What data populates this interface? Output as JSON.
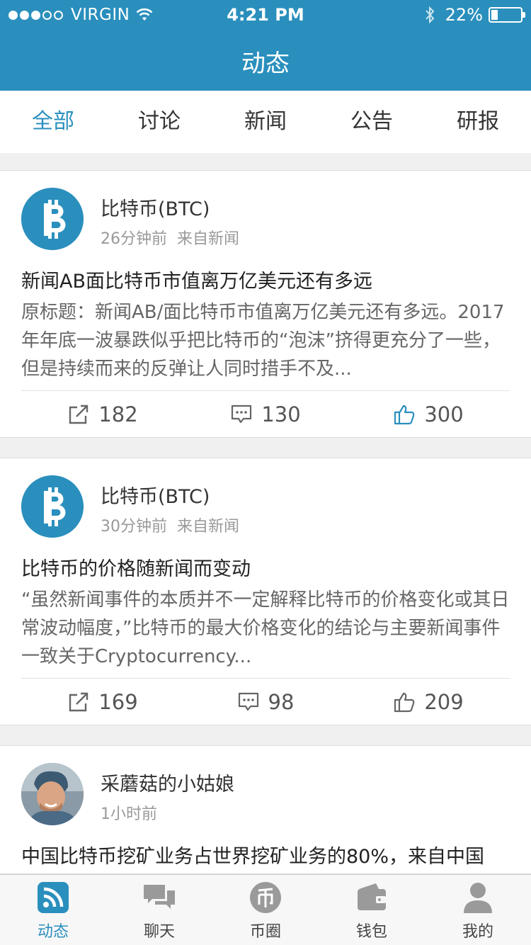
{
  "status_bar": {
    "carrier": "VIRGIN",
    "time": "4:21 PM",
    "battery": "22%",
    "battery_level": 0.22
  },
  "header": {
    "title": "动态"
  },
  "tabs": [
    {
      "label": "全部",
      "active": true
    },
    {
      "label": "讨论",
      "active": false
    },
    {
      "label": "新闻",
      "active": false
    },
    {
      "label": "公告",
      "active": false
    },
    {
      "label": "研报",
      "active": false
    }
  ],
  "feed": [
    {
      "author": "比特币(BTC)",
      "time": "26分钟前",
      "source": "来自新闻",
      "title": "新闻AB面比特币市值离万亿美元还有多远",
      "excerpt": "原标题：新闻AB/面比特币市值离万亿美元还有多远。2017年年底一波暴跌似乎把比特币的“泡沫”挤得更充分了一些，但是持续而来的反弹让人同时措手不及...",
      "shares": "182",
      "comments": "130",
      "likes": "300",
      "liked": true
    },
    {
      "author": "比特币(BTC)",
      "time": "30分钟前",
      "source": "来自新闻",
      "title": "比特币的价格随新闻而变动",
      "excerpt": "“虽然新闻事件的本质并不一定解释比特币的价格变化或其日常波动幅度，”比特币的最大价格变化的结论与主要新闻事件一致关于Cryptocurrency...",
      "shares": "169",
      "comments": "98",
      "likes": "209",
      "liked": false
    },
    {
      "author": "采蘑菇的小姑娘",
      "time": "1小时前",
      "title": "中国比特币挖矿业务占世界挖矿业务的80%，来自中国"
    }
  ],
  "tabbar": [
    {
      "label": "动态",
      "icon": "feed-icon",
      "active": true
    },
    {
      "label": "聊天",
      "icon": "chat-icon",
      "active": false
    },
    {
      "label": "币圈",
      "icon": "coin-circle-icon",
      "active": false
    },
    {
      "label": "钱包",
      "icon": "wallet-icon",
      "active": false
    },
    {
      "label": "我的",
      "icon": "profile-icon",
      "active": false
    }
  ],
  "colors": {
    "accent": "#2a8fbd",
    "background": "#f0f0f0",
    "text": "#333333",
    "muted": "#999999"
  }
}
